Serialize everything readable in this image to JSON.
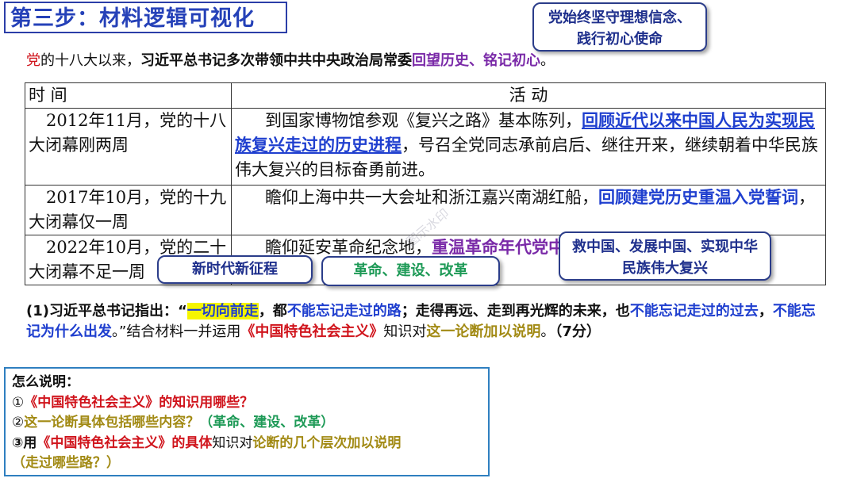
{
  "title": "第三步：材料逻辑可视化",
  "intro": {
    "party": "党",
    "part1": "的十八大以来，",
    "part2": "习近平总书记多次带领中共中央政治局常委",
    "part3": "回望历史、铭记初心",
    "end": "。"
  },
  "table": {
    "header_time": "时  间",
    "header_activity": "活  动",
    "rows": [
      {
        "time": "2012年11月，党的十八大闭幕刚两周",
        "act_plain1": "到国家博物馆参观《复兴之路》基本陈列，",
        "act_bold": "回顾近代以来中国人民为实现民族复兴走过的历史进程",
        "act_plain2": "，号召全党同志承前启后、继往开来，继续朝着中华民族伟大复兴的目标奋勇前进。"
      },
      {
        "time": "2017年10月，党的十九大闭幕仅一周",
        "act_plain1": "瞻仰上海中共一大会址和浙江嘉兴南湖红船，",
        "act_bold": "回顾建党历史重温入党誓词",
        "act_plain2": "，"
      },
      {
        "time": "2022年10月，党的二十大闭幕不足一周",
        "act_plain1": "瞻仰延安革命纪念地，",
        "act_bold": "重温革命年代党中央在延安的峥嵘岁月",
        "act_plain2": ""
      }
    ]
  },
  "question": {
    "p1": "(1)习近平总书记指出：“",
    "p2": "一切向前走",
    "p3": "，都",
    "p4": "不能忘记走过的路",
    "p5": "；走得再远、走到再光辉的未来，也",
    "p6": "不能忘记走过的过去",
    "p7": "，",
    "p8": "不能忘记为什么出发",
    "p9": "。”结合材料一并运用",
    "p10": "《中国特色社会主义》",
    "p11": "知识对",
    "p12": "这一论断加以说明",
    "p13": "。",
    "p14": "（7分）"
  },
  "how": {
    "heading": "怎么说明：",
    "l1_prefix": "①",
    "l1_red": "《中国特色社会主义》",
    "l1_rest": "的知识用哪些？",
    "l2_prefix": "②",
    "l2_olive": "这一论断具体包括哪些内容？",
    "l2_green": "（革命、建设、改革）",
    "l3_prefix": "③用",
    "l3_red": "《中国特色社会主义》",
    "l3_mid": "的具体",
    "l3_plain": "知识对",
    "l3_olive": "论断的几个层次加以说明",
    "l4_olive": "（走过哪些路？）"
  },
  "bubbles": {
    "mission": "党始终坚守理想信念、践行初心使命",
    "new_era": "新时代新征程",
    "rev": "革命、建设、改革",
    "save_china": "救中国、发展中国、实现中华民族伟大复兴"
  },
  "watermark": "图示水印",
  "colors": {
    "title": "#2541b8",
    "blue": "#1f3fcf",
    "purple": "#7a2aa8",
    "red": "#d0141c",
    "olive": "#a28a14",
    "green": "#1e9a57",
    "highlight": "#f5f500"
  }
}
